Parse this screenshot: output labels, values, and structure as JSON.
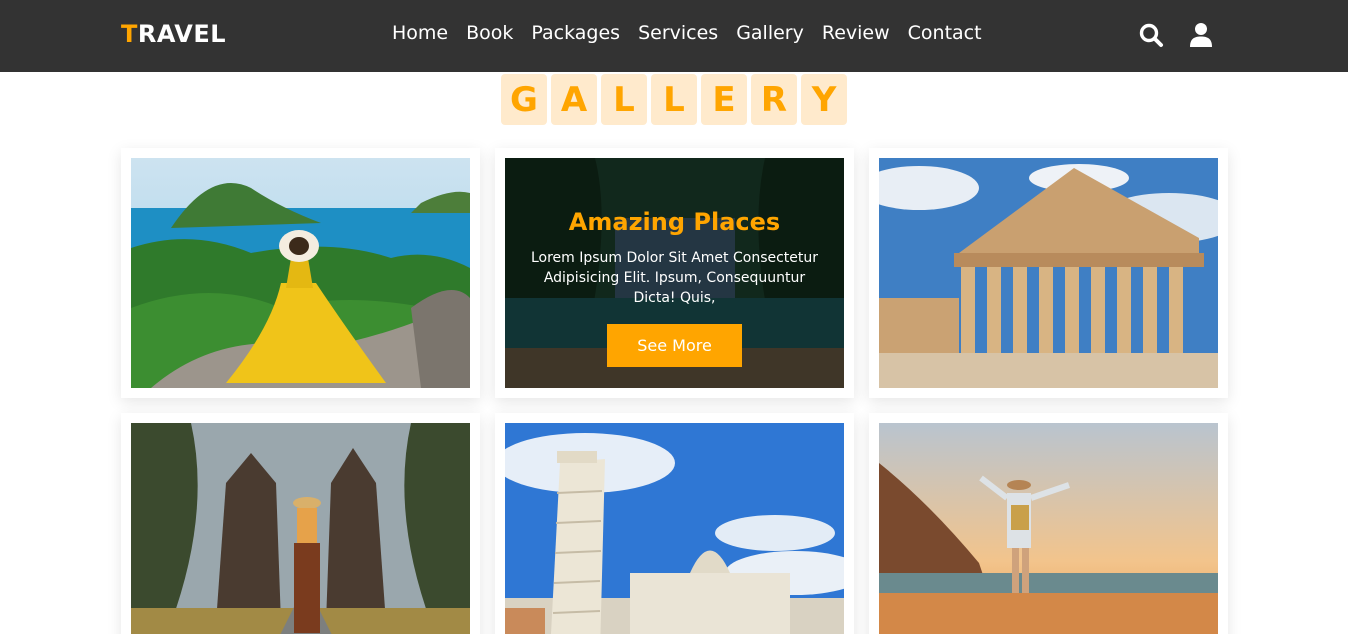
{
  "header": {
    "logo_first": "T",
    "logo_rest": "RAVEL",
    "nav": [
      "Home",
      "Book",
      "Packages",
      "Services",
      "Gallery",
      "Review",
      "Contact"
    ],
    "icons": [
      "search-icon",
      "user-icon"
    ]
  },
  "heading": {
    "letters": [
      "G",
      "A",
      "L",
      "L",
      "E",
      "R",
      "Y"
    ]
  },
  "featured": {
    "title": "Amazing Places",
    "text": "Lorem Ipsum Dolor Sit Amet Consectetur Adipisicing Elit. Ipsum, Consequuntur Dicta! Quis,",
    "button": "See More"
  },
  "colors": {
    "accent": "#ffa500",
    "header_bg": "#333333",
    "letter_bg": "#ffeacc"
  }
}
